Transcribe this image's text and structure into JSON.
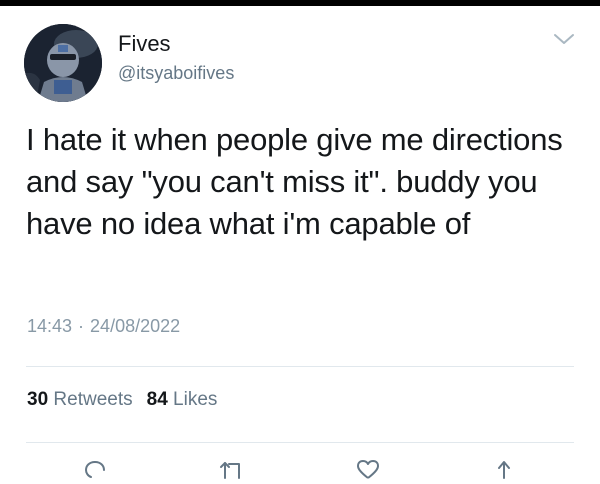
{
  "tweet": {
    "display_name": "Fives",
    "username": "@itsyaboifives",
    "text": "I hate it when people give me directions and say \"you can't miss it\". buddy you have no idea what i'm capable of",
    "time": "14:43",
    "separator": "·",
    "date": "24/08/2022"
  },
  "stats": {
    "retweets_count": "30",
    "retweets_label": "Retweets",
    "likes_count": "84",
    "likes_label": "Likes"
  },
  "icons": {
    "menu": "chevron-down-icon",
    "reply": "reply-icon",
    "retweet": "retweet-icon",
    "like": "heart-icon",
    "share": "share-icon"
  },
  "colors": {
    "text": "#14171a",
    "secondary": "#657786",
    "meta": "#8899a6",
    "divider": "#e1e8ed"
  }
}
